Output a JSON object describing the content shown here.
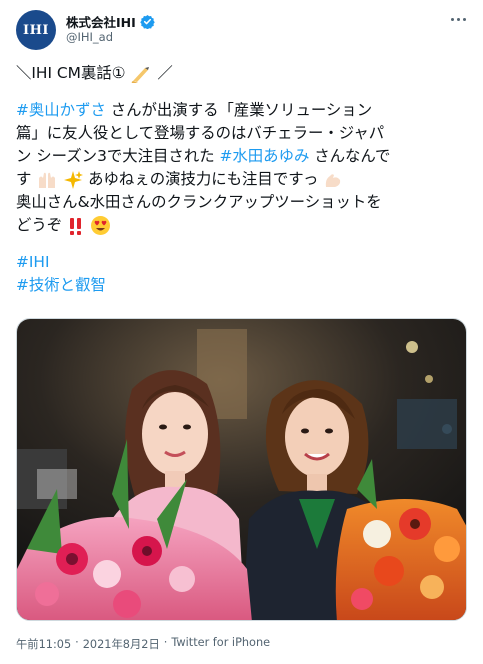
{
  "account": {
    "display_name": "株式会社IHI",
    "handle": "@IHI_ad",
    "avatar_text": "IHI"
  },
  "tweet": {
    "line1": "＼IHI CM裏話①",
    "line1_end": "／",
    "line2_tag": "#奥山かずさ",
    "line2_rest": " さんが出演する「産業ソリューション",
    "line3": "篇」に友人役として登場するのはバチェラー・ジャパ",
    "line4_pre": "ン シーズン3で大注目された ",
    "line4_tag": "#水田あゆみ",
    "line4_rest": " さんなんで",
    "line5_pre": "す",
    "line5_rest": "あゆねぇの演技力にも注目ですっ",
    "line6": "奥山さん&水田さんのクランクアップツーショットを",
    "line7": "どうぞ",
    "hashtag1": "#IHI",
    "hashtag2": "#技術と叡智"
  },
  "meta": {
    "time": "午前11:05",
    "dot1": "·",
    "date": "2021年8月2日",
    "dot2": "·",
    "source": "Twitter for iPhone"
  },
  "colors": {
    "link": "#1d9bf0",
    "text": "#0f1419",
    "secondary": "#536471",
    "avatar_bg": "#1a4a8c"
  },
  "icons": [
    "verified-badge-icon",
    "more-options-icon",
    "writing-hand-emoji",
    "raised-hands-emoji",
    "sparkles-emoji",
    "flexed-biceps-emoji",
    "double-exclamation-emoji",
    "heart-eyes-emoji"
  ]
}
